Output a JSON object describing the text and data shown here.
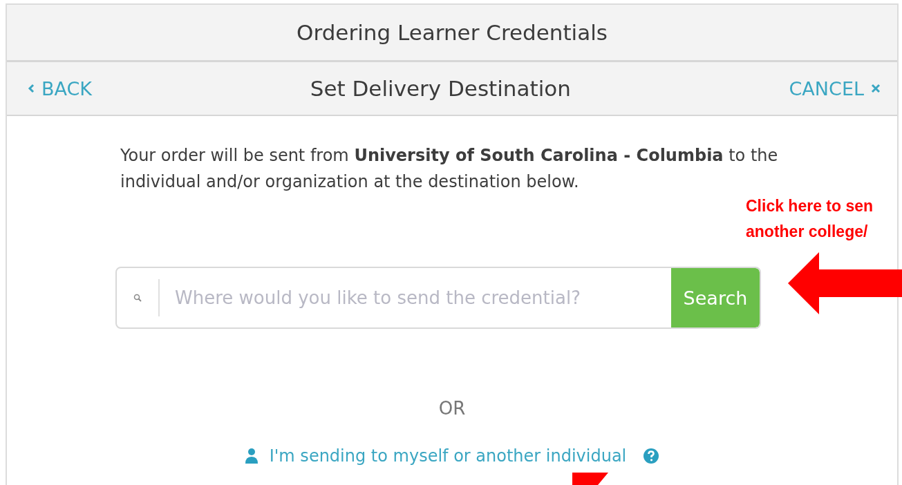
{
  "window": {
    "title": "Ordering Learner Credentials"
  },
  "nav": {
    "back": "BACK",
    "title": "Set Delivery Destination",
    "cancel": "CANCEL"
  },
  "intro": "Your order will be sent from **University of South Carolina - Columbia** to the individual and/or organization at the destination below.",
  "search": {
    "placeholder": "Where would you like to send the credential?",
    "button": "Search"
  },
  "separator": "OR",
  "individual_link": "I'm sending to myself or another individual",
  "annotations": [
    {
      "kind": "callout",
      "lines": [
        "Click here to sen",
        "another college/"
      ]
    }
  ]
}
